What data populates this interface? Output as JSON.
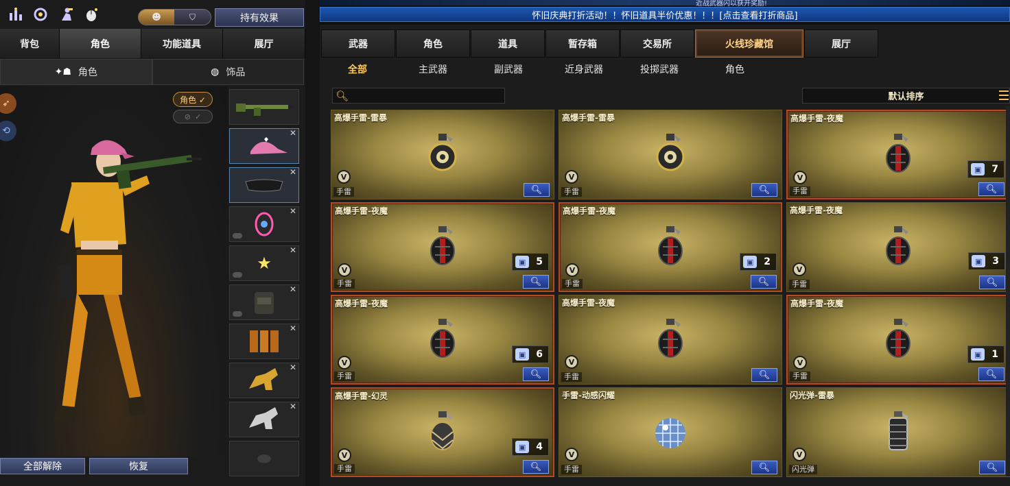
{
  "top_icons": [
    "shop-icon",
    "refresh-icon",
    "figure-icon",
    "mouse-icon"
  ],
  "effect_button": "持有效果",
  "left_tabs": [
    {
      "label": "背包",
      "active": false
    },
    {
      "label": "角色",
      "active": true
    },
    {
      "label": "功能道具",
      "active": false
    },
    {
      "label": "展厅",
      "active": false
    }
  ],
  "left_subtabs": [
    {
      "label": "角色",
      "active": true
    },
    {
      "label": "饰品",
      "active": false
    }
  ],
  "role_badge": "角色 ✓",
  "hide_badge_check": "✓",
  "equip_slots": [
    "rifle",
    "cap",
    "goggles",
    "dogtag",
    "star-wand",
    "backpack",
    "ammo-belt",
    "gold-horse",
    "silver-horse",
    "empty"
  ],
  "left_buttons": {
    "remove_all": "全部解除",
    "restore": "恢复"
  },
  "banner_top_text": "近战武器闪以获开奖励!",
  "banner_text": "怀旧庆典打折活动！！怀旧道具半价优惠！！！[点击查看打折商品]",
  "right_tabs": [
    {
      "label": "武器",
      "active": false
    },
    {
      "label": "角色",
      "active": false
    },
    {
      "label": "道具",
      "active": false
    },
    {
      "label": "暂存箱",
      "active": false
    },
    {
      "label": "交易所",
      "active": false
    },
    {
      "label": "火线珍藏馆",
      "active": true
    },
    {
      "label": "展厅",
      "active": false
    }
  ],
  "categories": [
    {
      "label": "全部",
      "active": true
    },
    {
      "label": "主武器",
      "active": false
    },
    {
      "label": "副武器",
      "active": false
    },
    {
      "label": "近身武器",
      "active": false
    },
    {
      "label": "投掷武器",
      "active": false
    },
    {
      "label": "角色",
      "active": false
    }
  ],
  "search": {
    "placeholder": ""
  },
  "sort_label": "默认排序",
  "cards": [
    {
      "name": "高爆手雷-雷暴",
      "type": "手雷",
      "count": null,
      "item": "grenade-thunder",
      "highlight": false
    },
    {
      "name": "高爆手雷-雷暴",
      "type": "手雷",
      "count": null,
      "item": "grenade-thunder",
      "highlight": false
    },
    {
      "name": "高爆手雷-夜魔",
      "type": "手雷",
      "count": "7",
      "item": "grenade-nightmare",
      "highlight": true
    },
    {
      "name": "高爆手雷-夜魔",
      "type": "手雷",
      "count": "5",
      "item": "grenade-nightmare",
      "highlight": true
    },
    {
      "name": "高爆手雷-夜魔",
      "type": "手雷",
      "count": "2",
      "item": "grenade-nightmare",
      "highlight": true
    },
    {
      "name": "高爆手雷-夜魔",
      "type": "手雷",
      "count": "3",
      "item": "grenade-nightmare",
      "highlight": false
    },
    {
      "name": "高爆手雷-夜魔",
      "type": "手雷",
      "count": "6",
      "item": "grenade-nightmare",
      "highlight": true
    },
    {
      "name": "高爆手雷-夜魔",
      "type": "手雷",
      "count": null,
      "item": "grenade-nightmare",
      "highlight": false
    },
    {
      "name": "高爆手雷-夜魔",
      "type": "手雷",
      "count": "1",
      "item": "grenade-nightmare",
      "highlight": true
    },
    {
      "name": "高爆手雷-幻灵",
      "type": "手雷",
      "count": "4",
      "item": "grenade-phantom",
      "highlight": true
    },
    {
      "name": "手雷-动感闪耀",
      "type": "手雷",
      "count": null,
      "item": "grenade-discoball",
      "highlight": false
    },
    {
      "name": "闪光弹-雷暴",
      "type": "闪光弹",
      "count": null,
      "item": "flashbang-thunder",
      "highlight": false
    }
  ]
}
